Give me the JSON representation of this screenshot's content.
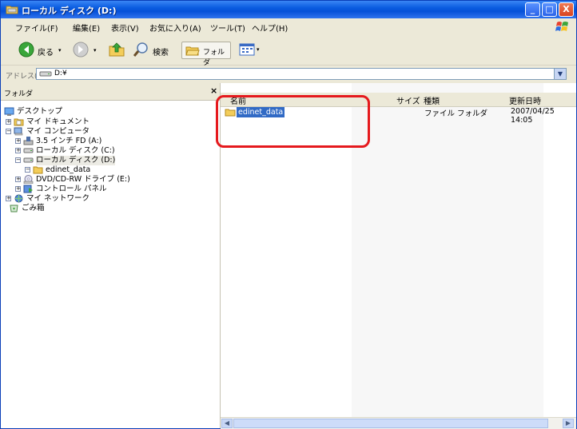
{
  "window": {
    "title": "ローカル ディスク (D:)",
    "controls": {
      "minimize": "_",
      "maximize": "□",
      "close": "X"
    }
  },
  "menu": {
    "items": [
      "ファイル(F)",
      "編集(E)",
      "表示(V)",
      "お気に入り(A)",
      "ツール(T)",
      "ヘルプ(H)"
    ]
  },
  "toolbar": {
    "back_label": "戻る",
    "search_label": "検索",
    "folders_label": "フォルダ"
  },
  "address": {
    "label": "アドレス(D)",
    "value": "D:¥"
  },
  "folder_pane": {
    "title": "フォルダ",
    "close": "×",
    "tree": [
      {
        "label": "デスクトップ",
        "icon": "desktop-icon"
      },
      {
        "label": "マイ ドキュメント",
        "icon": "my-documents-icon",
        "expander": "+"
      },
      {
        "label": "マイ コンピュータ",
        "icon": "my-computer-icon",
        "expander": "−"
      },
      {
        "label": "3.5 インチ FD (A:)",
        "icon": "floppy-icon",
        "expander": "+"
      },
      {
        "label": "ローカル ディスク (C:)",
        "icon": "drive-icon",
        "expander": "+"
      },
      {
        "label": "ローカル ディスク (D:)",
        "icon": "drive-icon",
        "expander": "−"
      },
      {
        "label": "edinet_data",
        "icon": "folder-icon",
        "expander": "−"
      },
      {
        "label": "DVD/CD-RW ドライブ (E:)",
        "icon": "cd-drive-icon",
        "expander": "+"
      },
      {
        "label": "コントロール パネル",
        "icon": "control-panel-icon",
        "expander": "+"
      },
      {
        "label": "マイ ネットワーク",
        "icon": "network-icon",
        "expander": "+"
      },
      {
        "label": "ごみ箱",
        "icon": "recycle-bin-icon"
      }
    ]
  },
  "file_list": {
    "columns": [
      "名前",
      "サイズ",
      "種類",
      "更新日時"
    ],
    "rows": [
      {
        "name": "edinet_data",
        "size": "",
        "type": "ファイル フォルダ",
        "modified": "2007/04/25 14:05"
      }
    ]
  },
  "colors": {
    "selection": "#316ac5",
    "highlight_ring": "#e5191d",
    "titlebar": "#0a5ce0"
  }
}
